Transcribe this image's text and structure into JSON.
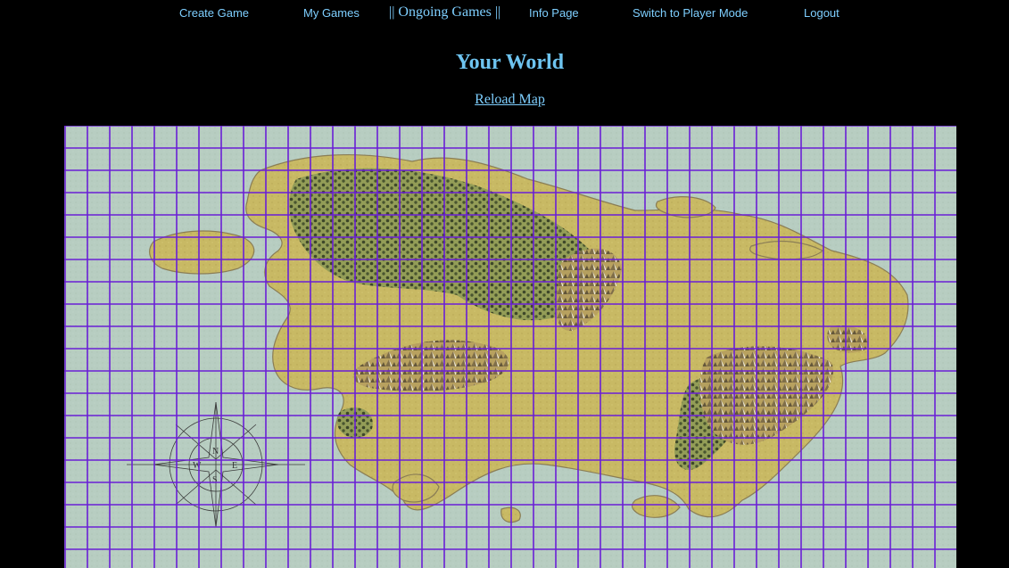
{
  "nav": {
    "create_game": "Create Game",
    "my_games": "My Games",
    "ongoing_games": "|| Ongoing Games ||",
    "info_page": "Info Page",
    "switch_mode": "Switch to Player Mode",
    "logout": "Logout"
  },
  "page": {
    "title": "Your World",
    "reload_link": "Reload Map"
  },
  "map": {
    "compass_letters": [
      "N",
      "E",
      "S",
      "W"
    ]
  },
  "colors": {
    "link": "#7ecfff",
    "title": "#6ec4f0",
    "background": "#000000",
    "grid_line": "#6a1fd6",
    "sea": "#b9cfc4",
    "land": "#c9b962",
    "forest": "#2f3a22",
    "mountain": "#8a7a5a"
  }
}
